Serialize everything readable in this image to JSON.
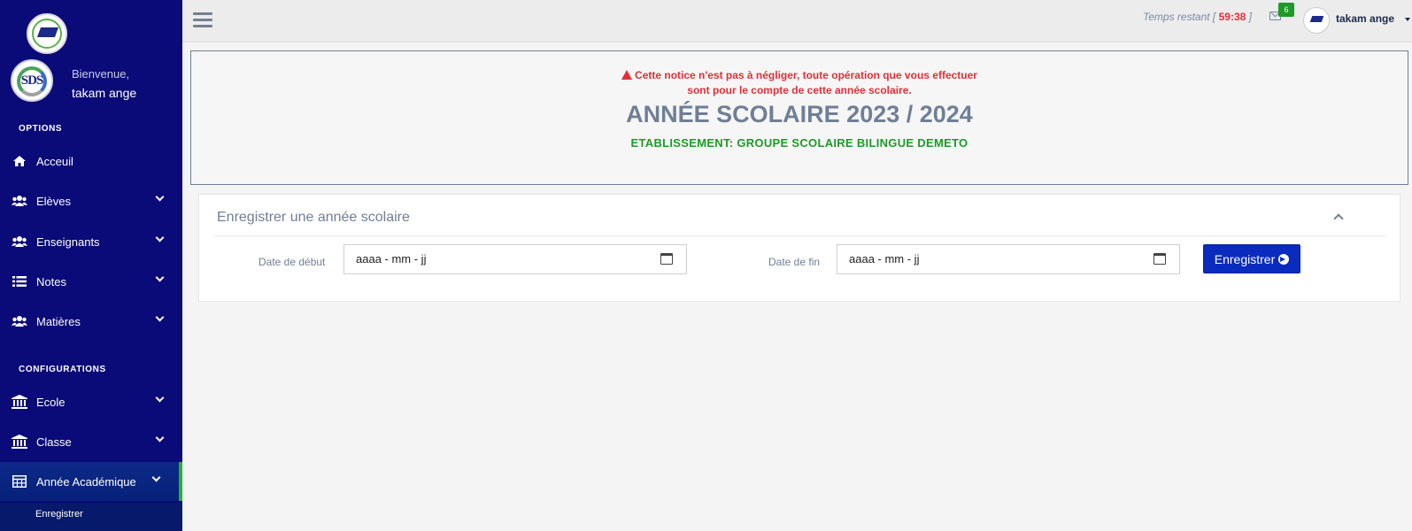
{
  "sidebar": {
    "welcome": "Bienvenue,",
    "user_name": "takam ange",
    "sections": {
      "options": "OPTIONS",
      "configurations": "CONFIGURATIONS"
    },
    "items": [
      {
        "label": "Acceuil",
        "icon": "home-icon"
      },
      {
        "label": "Elèves",
        "icon": "users-icon"
      },
      {
        "label": "Enseignants",
        "icon": "users-icon"
      },
      {
        "label": "Notes",
        "icon": "list-icon"
      },
      {
        "label": "Matières",
        "icon": "users-icon"
      },
      {
        "label": "Ecole",
        "icon": "bank-icon"
      },
      {
        "label": "Classe",
        "icon": "bank-icon"
      },
      {
        "label": "Année Académique",
        "icon": "table-icon"
      }
    ],
    "sub_item": "Enregistrer"
  },
  "topbar": {
    "time_label": "Temps restant",
    "time_value": "59:38",
    "mail_count": "6",
    "user_name": "takam ange"
  },
  "notice": {
    "warning_line1": "Cette notice n'est pas à négliger, toute opération que vous effectuer",
    "warning_line2": "sont pour le compte de cette année scolaire.",
    "year": "ANNÉE SCOLAIRE 2023 / 2024",
    "school": "ETABLISSEMENT: GROUPE SCOLAIRE BILINGUE DEMETO"
  },
  "form": {
    "title": "Enregistrer une année scolaire",
    "start_label": "Date de début",
    "start_placeholder": "aaaa - mm - jj",
    "end_label": "Date de fin",
    "end_placeholder": "aaaa - mm - jj",
    "submit_label": "Enregistrer"
  },
  "colors": {
    "sidebar": "#0a0a78",
    "accent_green": "#1e9a28",
    "warning_red": "#e1303a",
    "button_blue": "#0a2bbd"
  }
}
